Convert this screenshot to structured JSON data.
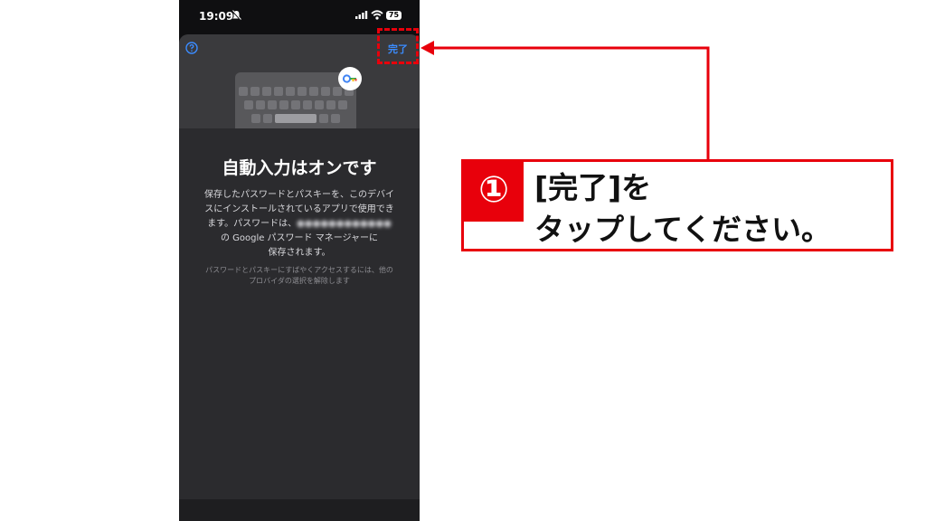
{
  "status_bar": {
    "time": "19:09",
    "battery": "75"
  },
  "sheet": {
    "done_label": "完了",
    "title": "自動入力はオンです",
    "body_line1": "保存したパスワードとパスキーを、このデバイ",
    "body_line2": "スにインストールされているアプリで使用でき",
    "body_line3_prefix": "ます。パスワードは、",
    "body_line3_blurred": "●●●●●●●●●●●●",
    "body_line4": "の Google パスワード マネージャーに",
    "body_line5": "保存されます。",
    "note_line1": "パスワードとパスキーにすばやくアクセスするには、他の",
    "note_line2": "プロバイダの選択を解除します"
  },
  "callout": {
    "number": "①",
    "line1": "[完了]を",
    "line2": "タップしてください。"
  },
  "colors": {
    "accent": "#e8000b",
    "link": "#3b8cff"
  },
  "icons": [
    "bell-slash-icon",
    "signal-icon",
    "wifi-icon",
    "help-icon",
    "key-icon"
  ]
}
